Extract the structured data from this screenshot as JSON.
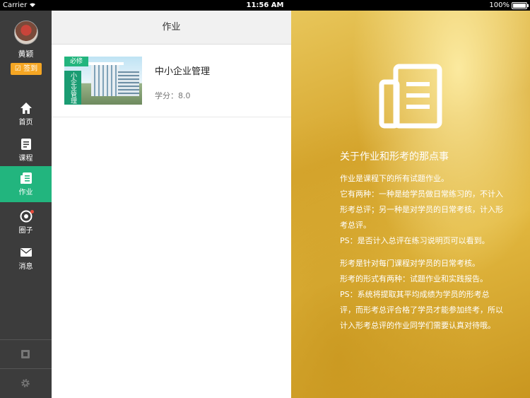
{
  "status_bar": {
    "carrier": "Carrier",
    "time": "11:56 AM",
    "battery": "100%"
  },
  "sidebar": {
    "username": "黄颖",
    "checkin_label": "签到",
    "nav": [
      {
        "label": "首页",
        "icon": "home-icon"
      },
      {
        "label": "课程",
        "icon": "course-icon"
      },
      {
        "label": "作业",
        "icon": "homework-icon",
        "active": true
      },
      {
        "label": "圈子",
        "icon": "circle-icon",
        "badge": true
      },
      {
        "label": "消息",
        "icon": "mail-icon"
      }
    ],
    "bottom_icons": [
      "archive-icon",
      "gear-icon"
    ]
  },
  "main": {
    "header_title": "作业",
    "courses": [
      {
        "tag": "必修",
        "banner": "小企业管理",
        "title": "中小企业管理",
        "credit": "学分：8.0"
      }
    ]
  },
  "info_panel": {
    "title": "关于作业和形考的那点事",
    "paragraph1": "作业是课程下的所有试题作业。\n它有两种：一种是给学员做日常练习的，不计入形考总评；另一种是对学员的日常考核，计入形考总评。\nPS：是否计入总评在练习说明页可以看到。",
    "paragraph2": "形考是针对每门课程对学员的日常考核。\n形考的形式有两种：试题作业和实践报告。\nPS：系统将提取其平均成绩为学员的形考总评，而形考总评合格了学员才能参加终考，所以计入形考总评的作业同学们需要认真对待哦。"
  },
  "colors": {
    "accent": "#22b57e",
    "checkin": "#f5a623",
    "sidebar_bg": "#3c3c3c"
  }
}
